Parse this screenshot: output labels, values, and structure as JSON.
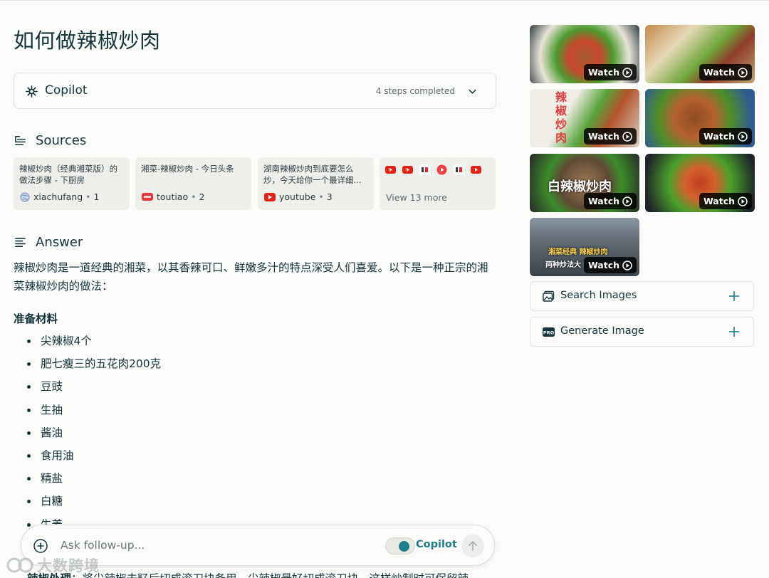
{
  "page": {
    "title": "如何做辣椒炒肉"
  },
  "copilot": {
    "label": "Copilot",
    "steps": "4 steps completed",
    "icon": "copilot-sparkle-icon"
  },
  "sources": {
    "heading": "Sources",
    "items": [
      {
        "title": "辣椒炒肉（经典湘菜版）的做法步骤 - 下厨房",
        "site": "xiachufang",
        "num": "1",
        "favicon": "globe-icon"
      },
      {
        "title": "湘菜-辣椒炒肉 - 今日头条",
        "site": "toutiao",
        "num": "2",
        "favicon": "toutiao-icon"
      },
      {
        "title": "湖南辣椒炒肉到底要怎么炒，今天给你一个最详细...",
        "site": "youtube",
        "num": "3",
        "favicon": "youtube-icon"
      }
    ],
    "more_label": "View 13 more",
    "more_icons": [
      "youtube-icon",
      "youtube-icon",
      "haokan-icon",
      "play-icon",
      "haokan-icon",
      "youtube-icon"
    ]
  },
  "answer": {
    "heading": "Answer",
    "intro": "辣椒炒肉是一道经典的湘菜，以其香辣可口、鲜嫩多汁的特点深受人们喜爱。以下是一种正宗的湘菜辣椒炒肉的做法：",
    "ingredients_heading": "准备材料",
    "ingredients": [
      "尖辣椒4个",
      "肥七瘦三的五花肉200克",
      "豆豉",
      "生抽",
      "酱油",
      "食用油",
      "精盐",
      "白糖",
      "生姜"
    ],
    "partial_bold": "辣椒处理",
    "partial_text": "：将尖辣椒去籽后切成滚刀块备用。尖辣椒最好切成滚刀块，这样炒制时可保留辣"
  },
  "followup": {
    "placeholder": "Ask follow-up...",
    "toggle_label": "Copilot",
    "toggle_on": true
  },
  "watermark": {
    "text": "大数跨境"
  },
  "media": {
    "watch_label": "Watch",
    "captions": [
      "辣椒炒肉",
      "白辣椒炒肉",
      "湘菜经典 辣椒炒肉",
      "两种炒法大"
    ],
    "search_images_label": "Search Images",
    "generate_image_label": "Generate Image"
  },
  "colors": {
    "accent": "#1f7e8c",
    "text": "#13343b",
    "background": "#fbfbf9"
  }
}
